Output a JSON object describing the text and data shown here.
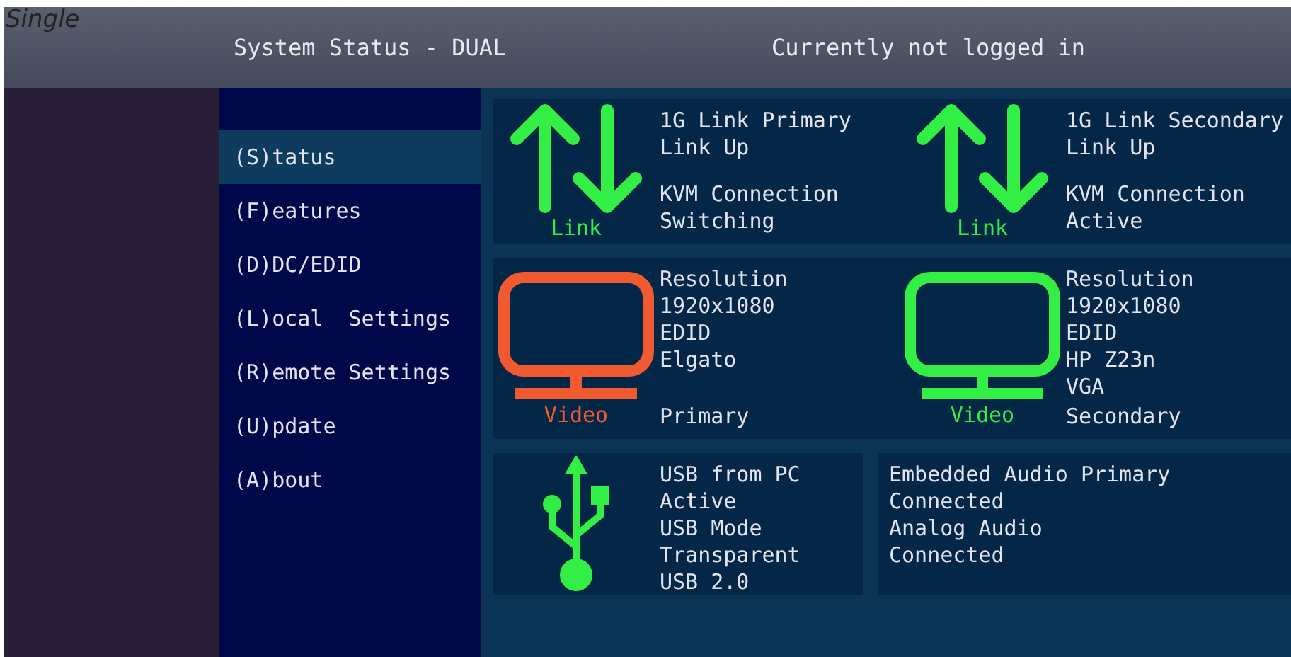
{
  "caption": "Single",
  "header": {
    "title": "System Status - DUAL",
    "login": "Currently not logged in"
  },
  "menu": [
    {
      "label": "(S)tatus",
      "selected": true
    },
    {
      "label": "(F)eatures",
      "selected": false
    },
    {
      "label": "(D)DC/EDID",
      "selected": false
    },
    {
      "label": "(L)ocal  Settings",
      "selected": false
    },
    {
      "label": "(R)emote Settings",
      "selected": false
    },
    {
      "label": "(U)pdate",
      "selected": false
    },
    {
      "label": "(A)bout",
      "selected": false
    }
  ],
  "links": [
    {
      "label": "Link",
      "groups": [
        [
          "1G Link Primary",
          "Link Up"
        ],
        [
          "KVM Connection",
          "Switching"
        ]
      ]
    },
    {
      "label": "Link",
      "groups": [
        [
          "1G Link Secondary",
          "Link Up"
        ],
        [
          "KVM Connection",
          "Active"
        ]
      ]
    }
  ],
  "videos": [
    {
      "label": "Video",
      "color": "#f05a30",
      "lines": [
        "Resolution",
        "1920x1080",
        "EDID",
        "Elgato"
      ],
      "footer": "Primary"
    },
    {
      "label": "Video",
      "color": "#33ee44",
      "lines": [
        "Resolution",
        "1920x1080",
        "EDID",
        "HP Z23n",
        "VGA"
      ],
      "footer": "Secondary"
    }
  ],
  "usb": {
    "lines": [
      "USB from PC",
      "Active",
      "USB Mode",
      "Transparent",
      "USB 2.0"
    ]
  },
  "audio": {
    "lines": [
      "Embedded Audio Primary",
      "Connected",
      "Analog Audio",
      "Connected"
    ]
  }
}
